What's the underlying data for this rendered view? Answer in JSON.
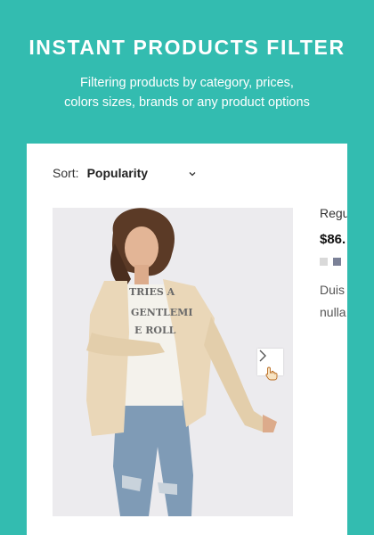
{
  "hero": {
    "title": "INSTANT PRODUCTS FILTER",
    "subtitle_line1": "Filtering products by category, prices,",
    "subtitle_line2": "colors sizes, brands or any product options"
  },
  "sort": {
    "label": "Sort:",
    "selected": "Popularity",
    "icon": "chevron-down-icon"
  },
  "product": {
    "name": "Regu",
    "price": "$86.",
    "swatches": [
      "#d9d9d9",
      "#7b8197"
    ],
    "description_line1": "Duis",
    "description_line2": "nulla",
    "image_graphic_text": [
      "TRIES A",
      "GENTLEMI",
      "E ROLL"
    ]
  },
  "colors": {
    "background": "#33bcb0",
    "card": "#ffffff",
    "image_background": "#ecebee"
  },
  "icons": {
    "next": "chevron-right-icon",
    "cursor": "hand-pointer-icon"
  }
}
